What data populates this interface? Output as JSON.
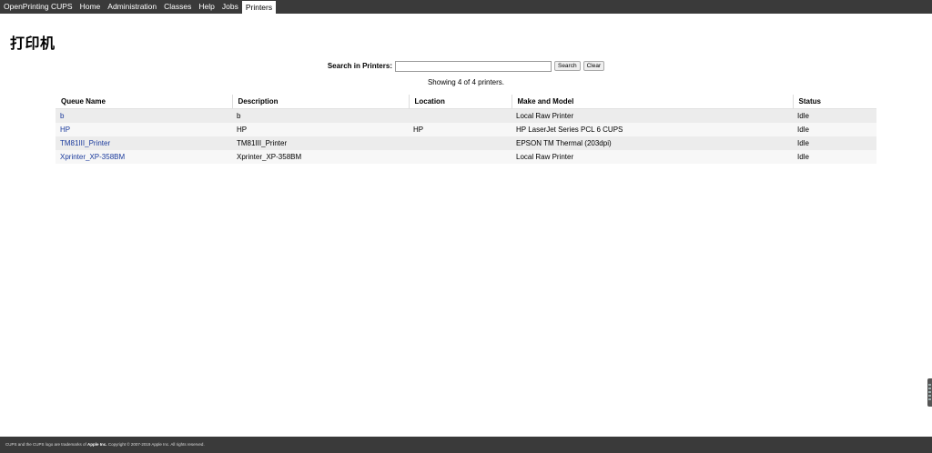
{
  "nav": {
    "items": [
      {
        "label": "OpenPrinting CUPS"
      },
      {
        "label": "Home"
      },
      {
        "label": "Administration"
      },
      {
        "label": "Classes"
      },
      {
        "label": "Help"
      },
      {
        "label": "Jobs"
      },
      {
        "label": "Printers"
      }
    ],
    "active": "Printers"
  },
  "page": {
    "title": "打印机"
  },
  "search": {
    "label": "Search in Printers:",
    "value": "",
    "placeholder": "",
    "search_button": "Search",
    "clear_button": "Clear"
  },
  "showing_text": "Showing 4 of 4 printers.",
  "table": {
    "headers": [
      "Queue Name",
      "Description",
      "Location",
      "Make and Model",
      "Status"
    ],
    "rows": [
      [
        "b",
        "b",
        "",
        "Local Raw Printer",
        "Idle"
      ],
      [
        "HP",
        "HP",
        "HP",
        "HP LaserJet Series PCL 6 CUPS",
        "Idle"
      ],
      [
        "TM81III_Printer",
        "TM81III_Printer",
        "",
        "EPSON TM Thermal (203dpi)",
        "Idle"
      ],
      [
        "Xprinter_XP-358BM",
        "Xprinter_XP-358BM",
        "",
        "Local Raw Printer",
        "Idle"
      ]
    ]
  },
  "footer": {
    "prefix": "CUPS and the CUPS logo are trademarks of ",
    "company": "Apple Inc.",
    "suffix": " Copyright © 2007-2019 Apple Inc. All rights reserved."
  },
  "colors": {
    "nav_bg": "#3a3a3a",
    "link": "#1a3a9c",
    "row_odd": "#ececec",
    "row_even": "#f7f7f7"
  }
}
